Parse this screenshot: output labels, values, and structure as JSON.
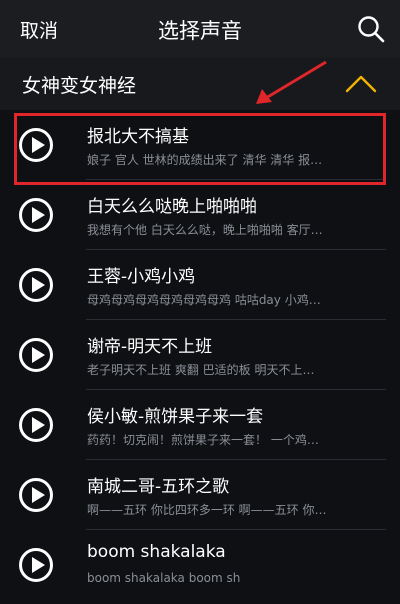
{
  "topbar": {
    "cancel_label": "取消",
    "title": "选择声音",
    "search_icon": "search-icon"
  },
  "section": {
    "title": "女神变女神经",
    "collapse_icon": "chevron-up-icon",
    "collapse_color": "#f2b200"
  },
  "accent_highlight": "#e0262b",
  "sounds": [
    {
      "title": "报北大不搞基",
      "subtitle": "娘子 官人 世林的成绩出来了 清华 清华 报…"
    },
    {
      "title": "白天么么哒晚上啪啪啪",
      "subtitle": "我想有个他 白天么么哒，晚上啪啪啪 客厅…"
    },
    {
      "title": "王蓉-小鸡小鸡",
      "subtitle": "母鸡母鸡母鸡母鸡母鸡母鸡  咕咕day  小鸡…"
    },
    {
      "title": "谢帝-明天不上班",
      "subtitle": "老子明天不上班 爽翻 巴适的板 明天不上…"
    },
    {
      "title": "侯小敏-煎饼果子来一套",
      "subtitle": "药药！切克闹！煎饼果子来一套！ 一个鸡…"
    },
    {
      "title": "南城二哥-五环之歌",
      "subtitle": "啊——五环 你比四环多一环 啊——五环 你…"
    },
    {
      "title": "boom shakalaka",
      "subtitle": "boom shakalaka boom sh"
    }
  ]
}
